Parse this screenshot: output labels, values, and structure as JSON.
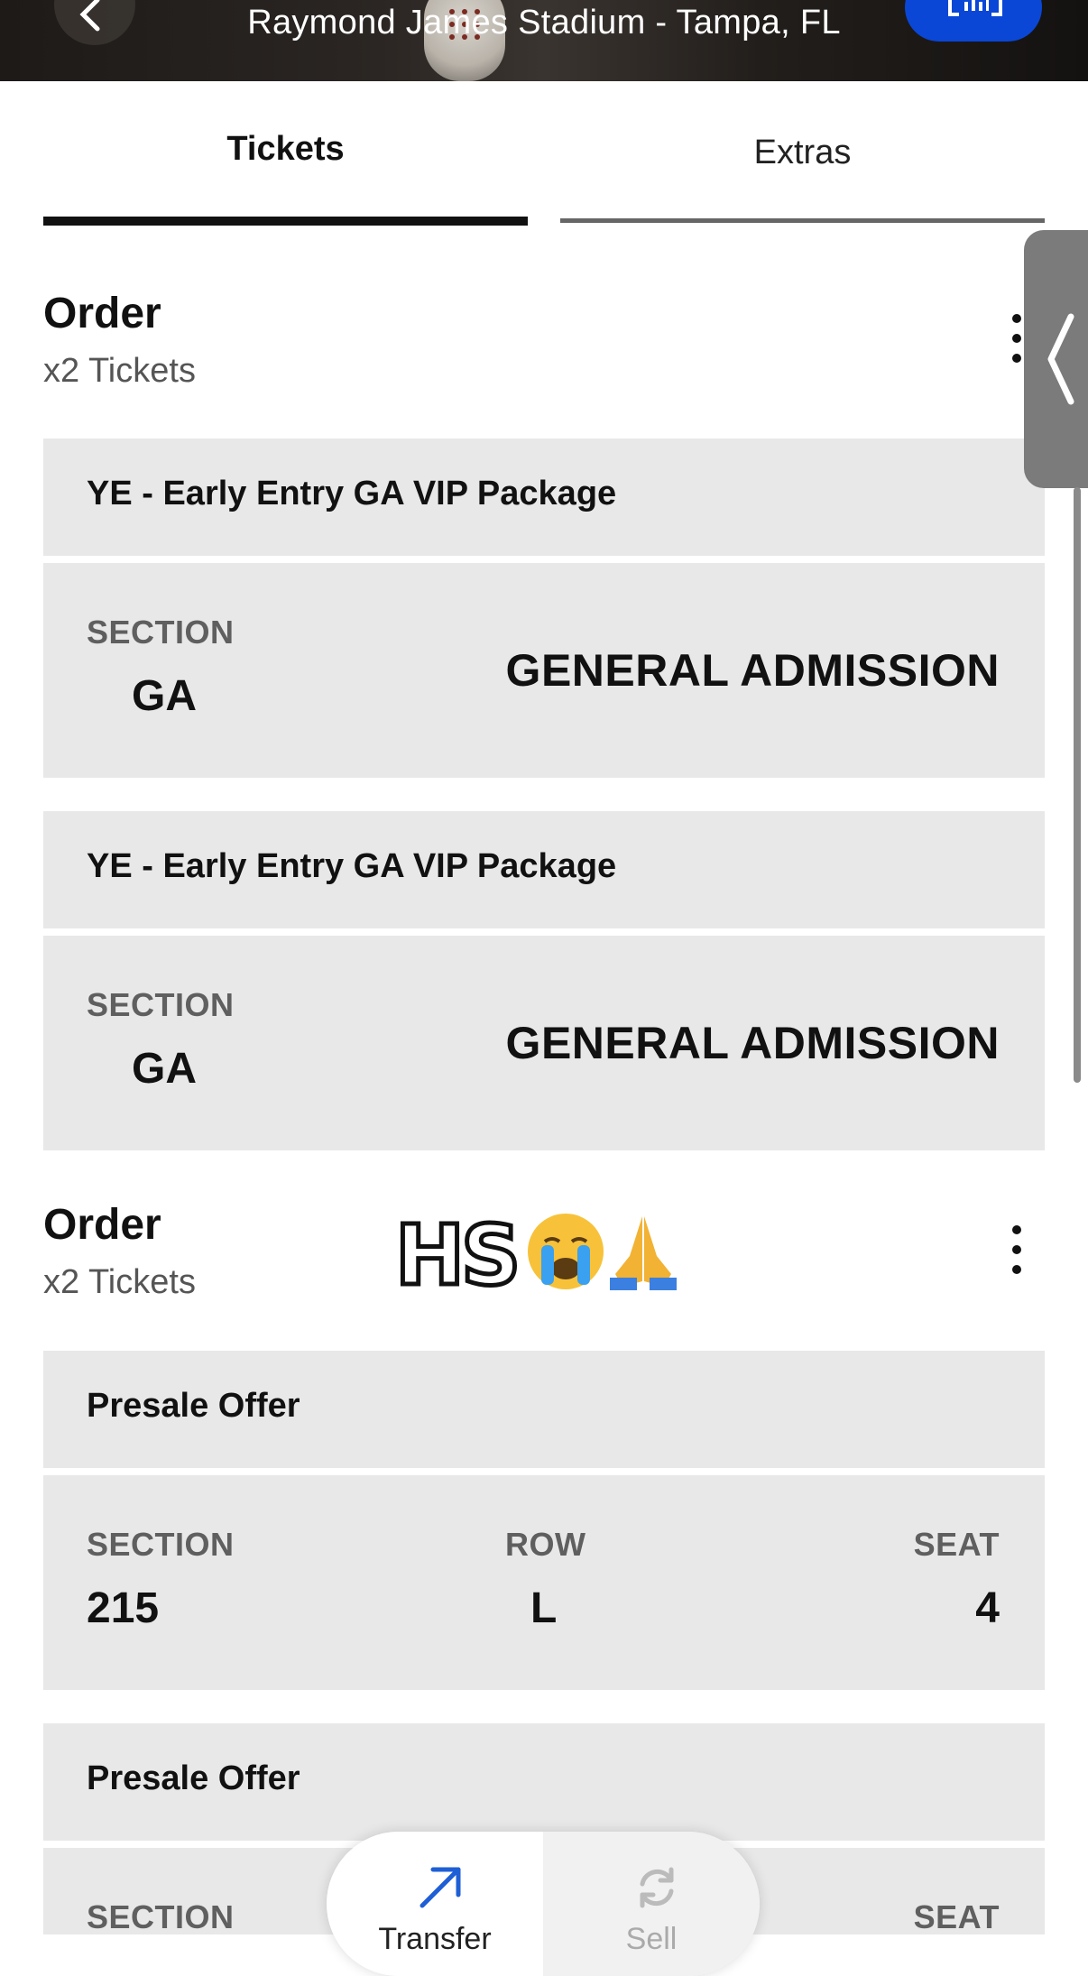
{
  "header": {
    "venue": "Raymond James Stadium - Tampa, FL"
  },
  "tabs": [
    {
      "label": "Tickets",
      "active": true
    },
    {
      "label": "Extras",
      "active": false
    }
  ],
  "orders": [
    {
      "title": "Order",
      "count": "x2 Tickets",
      "tickets": [
        {
          "package": "YE - Early Entry GA VIP Package",
          "section_label": "SECTION",
          "section": "GA",
          "admission": "GENERAL ADMISSION"
        },
        {
          "package": "YE - Early Entry GA VIP Package",
          "section_label": "SECTION",
          "section": "GA",
          "admission": "GENERAL ADMISSION"
        }
      ]
    },
    {
      "title": "Order",
      "count": "x2 Tickets",
      "tickets": [
        {
          "package": "Presale Offer",
          "section_label": "SECTION",
          "row_label": "ROW",
          "seat_label": "SEAT",
          "section": "215",
          "row": "L",
          "seat": "4"
        },
        {
          "package": "Presale Offer",
          "section_label": "SECTION",
          "seat_label": "SEAT"
        }
      ]
    }
  ],
  "sticker": {
    "text": "HS",
    "emojis": [
      "crying-face",
      "folded-hands"
    ]
  },
  "actions": {
    "transfer_label": "Transfer",
    "sell_label": "Sell"
  },
  "colors": {
    "accent_blue": "#0a47d6",
    "card_bg": "#e8e8e8",
    "transfer_icon": "#1f5fd6"
  }
}
